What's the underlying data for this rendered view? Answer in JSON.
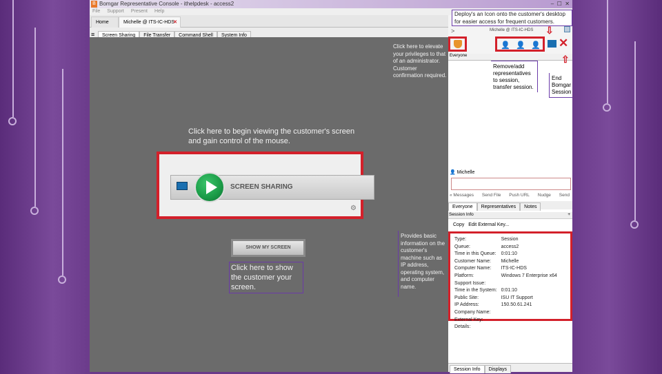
{
  "window": {
    "title": "Bomgar Representative Console - ithelpdesk - access2",
    "controls": [
      "–",
      "☐",
      "✕"
    ]
  },
  "menu": [
    "File",
    "Support",
    "Present",
    "Help"
  ],
  "tabs": [
    {
      "label": "Home"
    },
    {
      "label": "Michelle @ ITS-IC-HDS"
    }
  ],
  "subtabs": [
    "Screen Sharing",
    "File Transfer",
    "Command Shell",
    "System Info"
  ],
  "main": {
    "screen_sharing_hint": "Click here to begin viewing the customer's screen and gain control of the mouse.",
    "screen_sharing_label": "SCREEN SHARING",
    "show_my_screen_label": "SHOW MY SCREEN",
    "show_my_screen_hint": "Click here to show the customer your screen.",
    "elevate_hint": "Click here to elevate your privileges to that of an administrator. Customer confirmation required.",
    "session_info_hint": "Provides basic information on the customer's machine such as IP address, operating system, and computer name."
  },
  "right": {
    "deploy_hint": "Deploy's an Icon onto the customer's desktop for easier access for frequent customers.",
    "session_title": "Michelle @ ITS-IC-HDS",
    "reps_hint": "Remove/add representatives to session, transfer session.",
    "end_hint": "End Bomgar Session",
    "chat_header": "Everyone",
    "customer_name": "Michelle",
    "chat_actions": [
      "« Messages",
      "Send File",
      "Push URL",
      "Nudge",
      "Send"
    ],
    "chat_tabs": [
      "Everyone",
      "Representatives",
      "Notes"
    ],
    "session_info_header": "Session Info",
    "session_info_actions": [
      "Copy",
      "Edit External Key..."
    ],
    "session_info": [
      {
        "k": "Type:",
        "v": "Session"
      },
      {
        "k": "Queue:",
        "v": "access2"
      },
      {
        "k": "Time in this Queue:",
        "v": "0:01:10"
      },
      {
        "k": "Customer Name:",
        "v": "Michelle"
      },
      {
        "k": "Computer Name:",
        "v": "ITS-IC-HDS"
      },
      {
        "k": "Platform:",
        "v": "Windows 7 Enterprise x64"
      },
      {
        "k": "Support Issue:",
        "v": ""
      },
      {
        "k": "Time in the System:",
        "v": "0:01:10"
      },
      {
        "k": "Public Site:",
        "v": "ISU IT Support"
      },
      {
        "k": "IP Address:",
        "v": "150.50.61.241"
      },
      {
        "k": "Company Name:",
        "v": ""
      },
      {
        "k": "External Key:",
        "v": ""
      },
      {
        "k": "Details:",
        "v": ""
      }
    ],
    "bottom_tabs": [
      "Session Info",
      "Displays"
    ]
  },
  "colors": {
    "highlight_red": "#d3202a",
    "highlight_purple": "#6a3aa8",
    "play_green": "#1a9a46"
  }
}
